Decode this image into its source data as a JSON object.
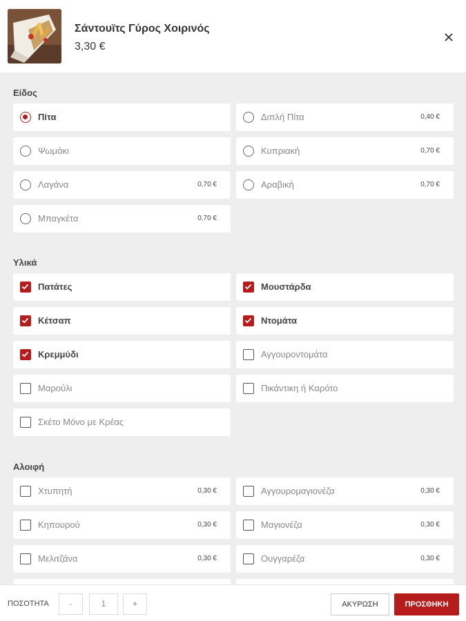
{
  "product": {
    "title": "Σάντουϊτς Γύρος Χοιρινός",
    "price": "3,30 €",
    "image": "gyros-pita-photo"
  },
  "icons": {
    "close": "close-icon"
  },
  "colors": {
    "accent": "#b71c1c",
    "panel_bg": "#eeeeee"
  },
  "sections": {
    "eidos": {
      "title": "Είδος",
      "type": "radio",
      "items": [
        {
          "label": "Πίτα",
          "price": "",
          "selected": true
        },
        {
          "label": "Διπλή Πίτα",
          "price": "0,40 €",
          "selected": false
        },
        {
          "label": "Ψωμάκι",
          "price": "",
          "selected": false
        },
        {
          "label": "Κυπριακή",
          "price": "0,70 €",
          "selected": false
        },
        {
          "label": "Λαγάνα",
          "price": "0,70 €",
          "selected": false
        },
        {
          "label": "Αραβική",
          "price": "0,70 €",
          "selected": false
        },
        {
          "label": "Μπαγκέτα",
          "price": "0,70 €",
          "selected": false
        }
      ]
    },
    "ylika": {
      "title": "Υλικά",
      "type": "checkbox",
      "items": [
        {
          "label": "Πατάτες",
          "price": "",
          "selected": true
        },
        {
          "label": "Μουστάρδα",
          "price": "",
          "selected": true
        },
        {
          "label": "Κέτσαπ",
          "price": "",
          "selected": true
        },
        {
          "label": "Ντομάτα",
          "price": "",
          "selected": true
        },
        {
          "label": "Κρεμμύδι",
          "price": "",
          "selected": true
        },
        {
          "label": "Αγγουροντομάτα",
          "price": "",
          "selected": false
        },
        {
          "label": "Μαρούλι",
          "price": "",
          "selected": false
        },
        {
          "label": "Πικάντικη ή Καρότο",
          "price": "",
          "selected": false
        },
        {
          "label": "Σκέτο Μόνο με Κρέας",
          "price": "",
          "selected": false
        }
      ]
    },
    "aloifi": {
      "title": "Αλοιφή",
      "type": "checkbox",
      "items": [
        {
          "label": "Χτυπητή",
          "price": "0,30 €",
          "selected": false
        },
        {
          "label": "Αγγουρομαγιονέζα",
          "price": "0,30 €",
          "selected": false
        },
        {
          "label": "Κηπουρού",
          "price": "0,30 €",
          "selected": false
        },
        {
          "label": "Μαγιονέζα",
          "price": "0,30 €",
          "selected": false
        },
        {
          "label": "Μελιτζάνα",
          "price": "0,30 €",
          "selected": false
        },
        {
          "label": "Ουγγαρέζα",
          "price": "0,30 €",
          "selected": false
        }
      ]
    }
  },
  "footer": {
    "qty_label": "ΠΟΣΟΤΗΤΑ",
    "minus": "-",
    "qty_value": "1",
    "plus": "+",
    "cancel_label": "ΑΚΥΡΩΣΗ",
    "add_label": "ΠΡΟΣΘΗΚΗ"
  }
}
